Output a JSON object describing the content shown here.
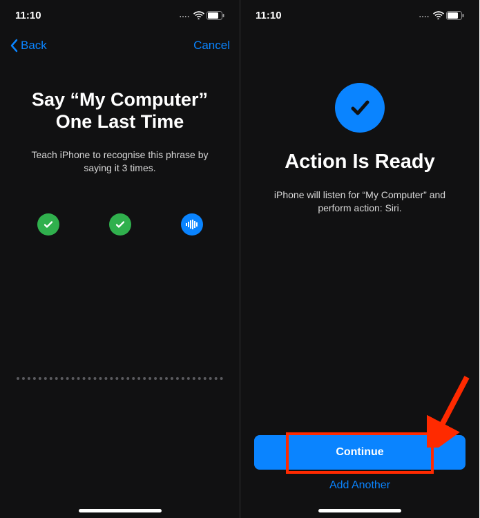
{
  "status": {
    "time": "11:10",
    "dots": "...."
  },
  "left": {
    "nav": {
      "back": "Back",
      "cancel": "Cancel"
    },
    "title_line1": "Say “My Computer”",
    "title_line2": "One Last Time",
    "subtext": "Teach iPhone to recognise this phrase by saying it 3 times.",
    "progress": [
      {
        "state": "done"
      },
      {
        "state": "done"
      },
      {
        "state": "recording"
      }
    ]
  },
  "right": {
    "title": "Action Is Ready",
    "subtext": "iPhone will listen for “My Computer” and perform action: Siri.",
    "continue_label": "Continue",
    "add_another_label": "Add Another"
  }
}
